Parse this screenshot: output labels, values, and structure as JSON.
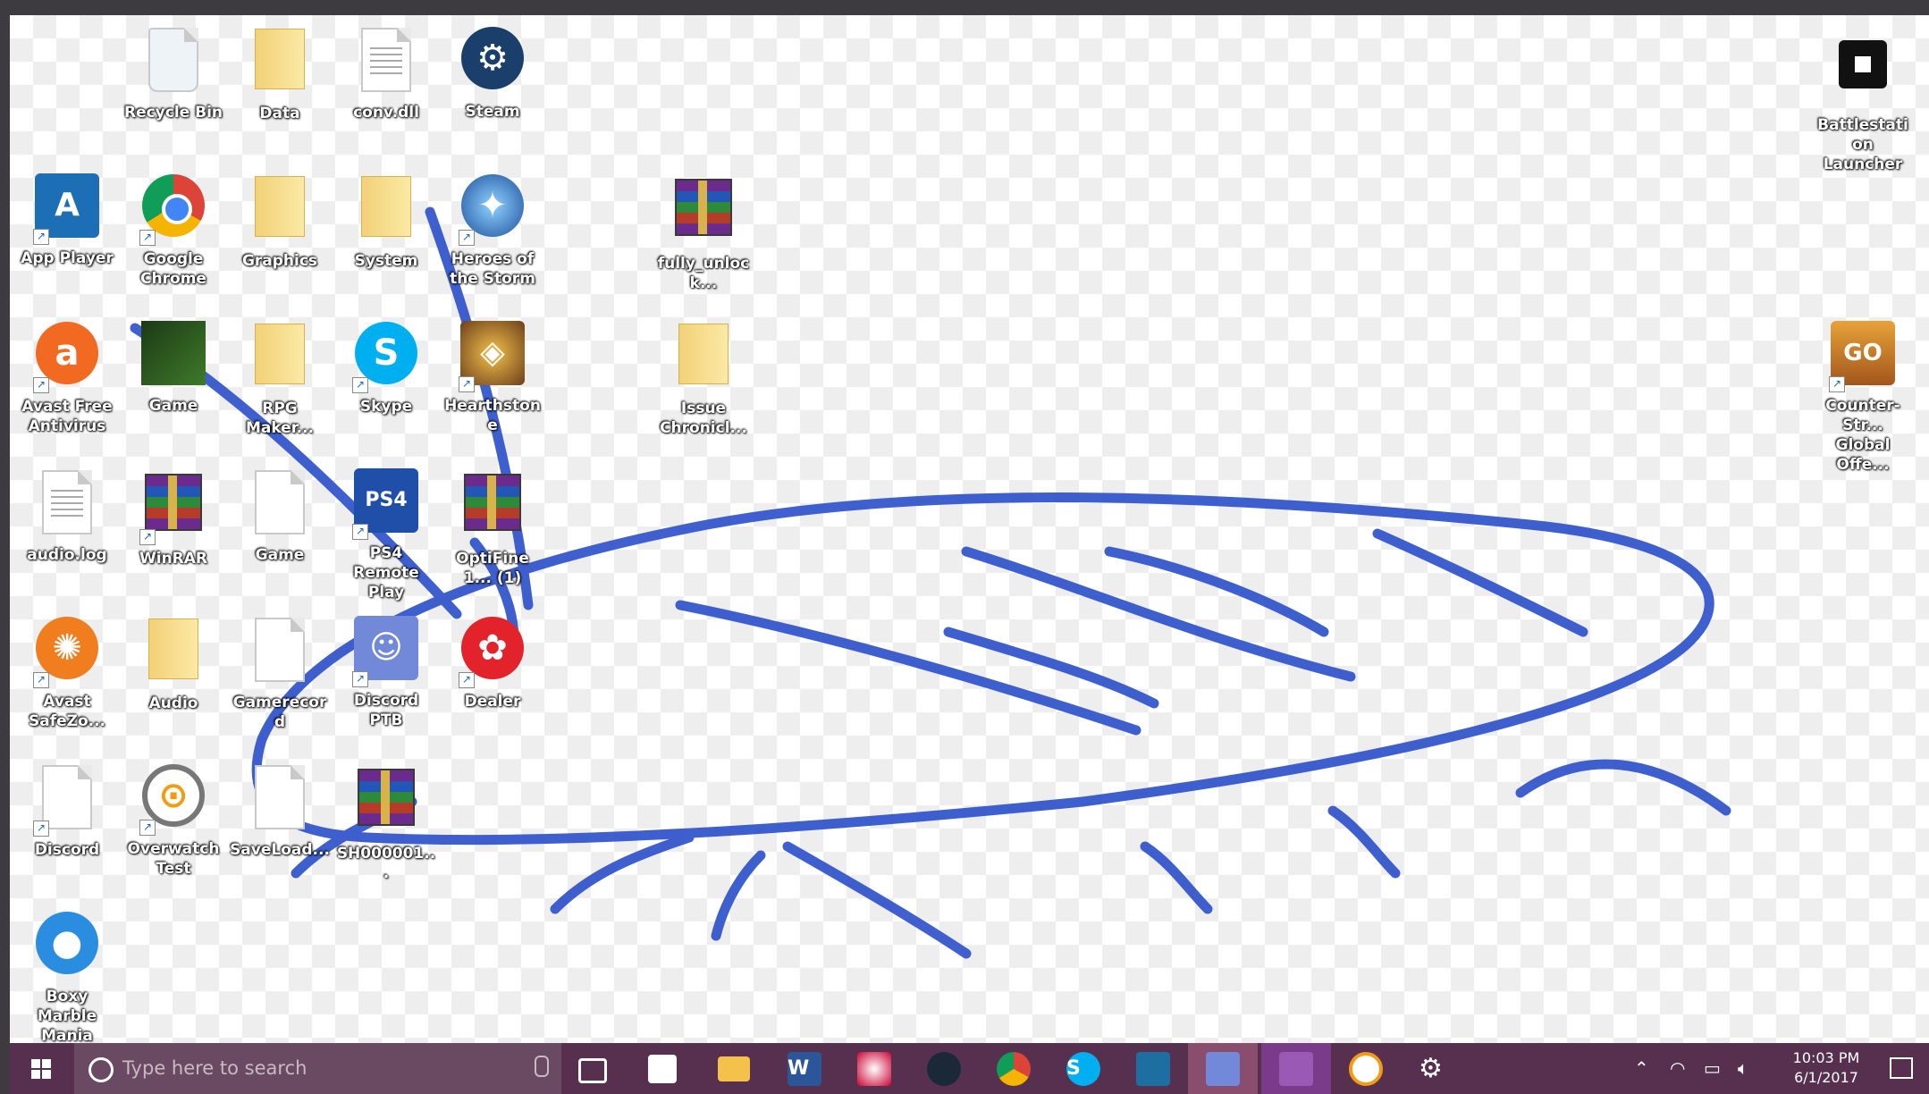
{
  "desktop": {
    "icons": [
      {
        "label": "Recycle Bin",
        "glyph": "recycle-bin-icon"
      },
      {
        "label": "Data",
        "glyph": "folder-icon"
      },
      {
        "label": "conv.dll",
        "glyph": "settings-file-icon"
      },
      {
        "label": "Steam",
        "glyph": "steam-icon"
      },
      {
        "label": "App Player",
        "glyph": "app-player-icon"
      },
      {
        "label": "Google Chrome",
        "glyph": "chrome-icon"
      },
      {
        "label": "Graphics",
        "glyph": "folder-icon"
      },
      {
        "label": "System",
        "glyph": "folder-icon"
      },
      {
        "label": "Heroes of the Storm",
        "glyph": "heroes-icon"
      },
      {
        "label": "fully_unlock...",
        "glyph": "winrar-archive-icon"
      },
      {
        "label": "Avast Free Antivirus",
        "glyph": "avast-icon"
      },
      {
        "label": "Game",
        "glyph": "minecraft-icon"
      },
      {
        "label": "RPG Maker...",
        "glyph": "folder-icon"
      },
      {
        "label": "Skype",
        "glyph": "skype-icon"
      },
      {
        "label": "Hearthstone",
        "glyph": "hearthstone-icon"
      },
      {
        "label": "Issue Chronicl...",
        "glyph": "folder-icon"
      },
      {
        "label": "Counter-Str... Global Offe...",
        "glyph": "csgo-icon"
      },
      {
        "label": "Battlestation Launcher",
        "glyph": "launcher-icon"
      },
      {
        "label": "audio.log",
        "glyph": "text-file-icon"
      },
      {
        "label": "WinRAR",
        "glyph": "winrar-icon"
      },
      {
        "label": "Game",
        "glyph": "settings-file-icon"
      },
      {
        "label": "PS4 Remote Play",
        "glyph": "ps4-icon"
      },
      {
        "label": "OptiFine 1... (1)",
        "glyph": "winrar-archive-icon"
      },
      {
        "label": "Avast SafeZo...",
        "glyph": "safezone-icon"
      },
      {
        "label": "Audio",
        "glyph": "folder-icon"
      },
      {
        "label": "Gamerecord",
        "glyph": "blank-file-icon"
      },
      {
        "label": "Discord PTB",
        "glyph": "discord-icon"
      },
      {
        "label": "Dealer",
        "glyph": "dealer-icon"
      },
      {
        "label": "Discord",
        "glyph": "blank-file-icon"
      },
      {
        "label": "Overwatch Test",
        "glyph": "overwatch-icon"
      },
      {
        "label": "SaveLoad...",
        "glyph": "blank-file-icon"
      },
      {
        "label": "SH000001...",
        "glyph": "winrar-archive-icon"
      },
      {
        "label": "Boxy Marble Mania",
        "glyph": "marble-icon"
      }
    ]
  },
  "taskbar": {
    "search_placeholder": "Type here to search",
    "pinned": [
      {
        "name": "task-view-icon"
      },
      {
        "name": "store-icon"
      },
      {
        "name": "file-explorer-icon"
      },
      {
        "name": "word-icon",
        "text": "W"
      },
      {
        "name": "paint-icon"
      },
      {
        "name": "steam-taskbar-icon"
      },
      {
        "name": "chrome-taskbar-icon"
      },
      {
        "name": "skype-taskbar-icon",
        "text": "S"
      },
      {
        "name": "window-app-icon"
      },
      {
        "name": "discord-taskbar-icon"
      },
      {
        "name": "purple-app-icon"
      },
      {
        "name": "overwatch-taskbar-icon"
      },
      {
        "name": "settings-taskbar-icon"
      }
    ],
    "clock_time": "10:03 PM",
    "clock_date": "6/1/2017"
  },
  "colors": {
    "scribble": "#2a4fc9",
    "taskbar": "#56304e"
  }
}
